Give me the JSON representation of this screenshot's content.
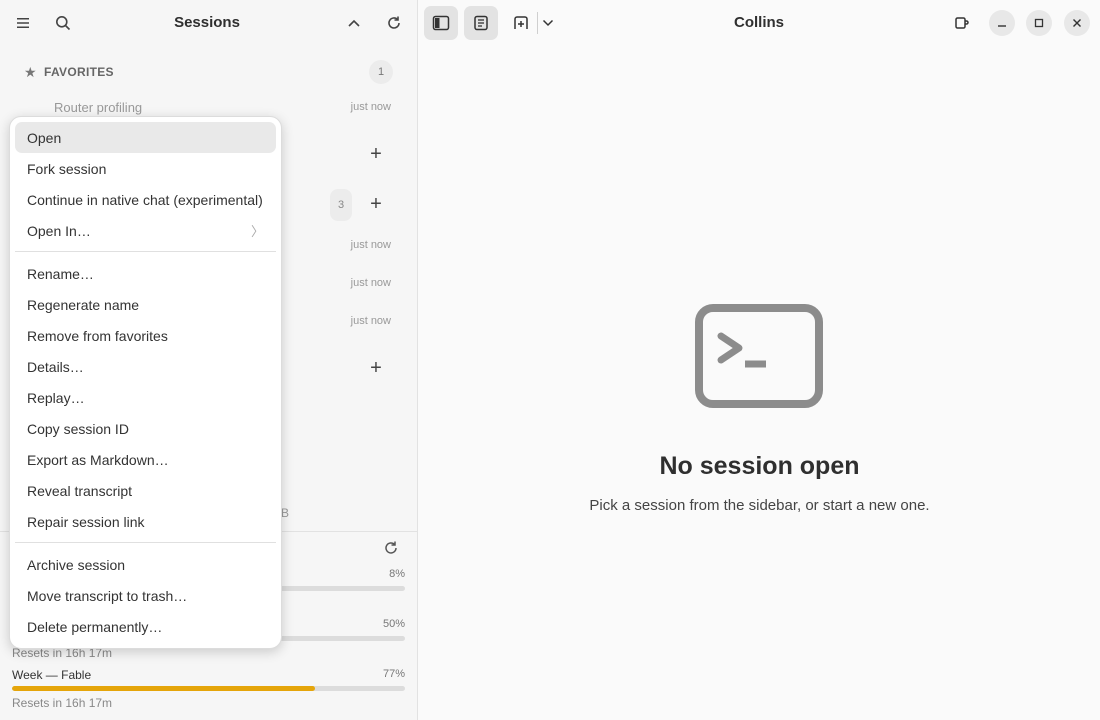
{
  "sidebar": {
    "title": "Sessions",
    "favorites": {
      "label": "FAVORITES",
      "count": "1",
      "items": [
        {
          "title": "Router profiling",
          "time": "just now"
        }
      ]
    },
    "group_count": "3",
    "times": [
      "just now",
      "just now",
      "just now"
    ],
    "fragment": "B",
    "usage": [
      {
        "name": "",
        "percent": "8%",
        "fraction": 0.08,
        "reset": ""
      },
      {
        "name": "",
        "percent": "50%",
        "fraction": 0.5,
        "reset": "Resets in 16h 17m"
      },
      {
        "name": "Week — Fable",
        "percent": "77%",
        "fraction": 0.77,
        "reset": "Resets in 16h 17m",
        "color": "#e5a50a"
      }
    ]
  },
  "menu": {
    "groups": [
      [
        "Open",
        "Fork session",
        "Continue in native chat (experimental)",
        "Open In…"
      ],
      [
        "Rename…",
        "Regenerate name",
        "Remove from favorites",
        "Details…",
        "Replay…",
        "Copy session ID",
        "Export as Markdown…",
        "Reveal transcript",
        "Repair session link"
      ],
      [
        "Archive session",
        "Move transcript to trash…",
        "Delete permanently…"
      ]
    ],
    "submenu_chevron": "〉"
  },
  "main": {
    "title": "Collins",
    "empty_title": "No session open",
    "empty_subtitle": "Pick a session from the sidebar, or start a new one."
  },
  "colors": {
    "accent": "#e5a50a",
    "empty_icon": "#8c8c8c"
  }
}
